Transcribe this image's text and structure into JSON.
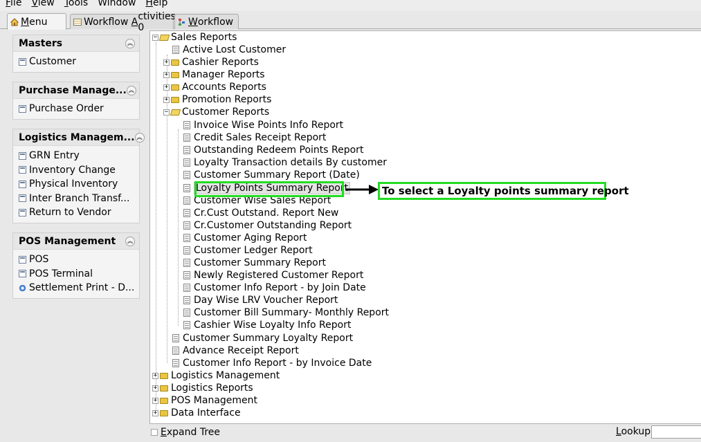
{
  "menubar": {
    "items": [
      {
        "pre": "",
        "mnemonic": "F",
        "post": "ile"
      },
      {
        "pre": "",
        "mnemonic": "V",
        "post": "iew"
      },
      {
        "pre": "",
        "mnemonic": "T",
        "post": "ools"
      },
      {
        "pre": "Window",
        "mnemonic": "",
        "post": ""
      },
      {
        "pre": "",
        "mnemonic": "H",
        "post": "elp"
      }
    ]
  },
  "tabs": {
    "menu": {
      "mnemonic": "M",
      "rest": "enu"
    },
    "workflow_activities": {
      "pre": "Workflow ",
      "mnemonic": "A",
      "post": "ctivities: 0"
    },
    "workflow": {
      "mnemonic": "W",
      "rest": "orkflow"
    }
  },
  "left": {
    "masters": {
      "title": "Masters",
      "items": [
        "Customer"
      ]
    },
    "purchase": {
      "title": "Purchase Manage...",
      "items": [
        "Purchase Order"
      ]
    },
    "logistics": {
      "title": "Logistics Managem...",
      "items": [
        "GRN Entry",
        "Inventory Change",
        "Physical Inventory",
        "Inter Branch Transf...",
        "Return to Vendor"
      ]
    },
    "pos": {
      "title": "POS Management",
      "items": [
        "POS",
        "POS Terminal",
        "Settlement Print - D..."
      ]
    }
  },
  "tree": {
    "sales_reports": "Sales Reports",
    "active_lost_customer": "Active Lost Customer",
    "cashier_reports": "Cashier Reports",
    "manager_reports": "Manager Reports",
    "accounts_reports": "Accounts Reports",
    "promotion_reports": "Promotion Reports",
    "customer_reports": "Customer Reports",
    "customer_children": [
      "Invoice Wise Points Info Report",
      "Credit Sales Receipt Report",
      "Outstanding Redeem Points Report",
      "Loyalty Transaction details By customer",
      "Customer Summary Report (Date)",
      "Loyalty Points Summary Report",
      "Customer Wise Sales Report",
      "Cr.Cust Outstand. Report New",
      "Cr.Customer Outstanding Report",
      "Customer Aging Report",
      "Customer Ledger Report",
      "Customer Summary Report",
      "Newly Registered Customer Report",
      "Customer Info Report - by Join Date",
      "Day Wise LRV Voucher Report",
      "Customer Bill Summary- Monthly Report",
      "Cashier Wise Loyalty Info Report"
    ],
    "sales_leaves_after": [
      "Customer Summary Loyalty Report",
      "Advance Receipt Report",
      "Customer Info Report - by Invoice Date"
    ],
    "top_level_after": [
      "Logistics Management",
      "Logistics Reports",
      "POS Management",
      "Data Interface"
    ]
  },
  "annotation": {
    "text": "To select a Loyalty points summary report"
  },
  "bottom": {
    "expand_tree": {
      "mnemonic": "E",
      "rest": "xpand Tree"
    },
    "lookup": {
      "mnemonic": "L",
      "rest": "ookup"
    }
  }
}
